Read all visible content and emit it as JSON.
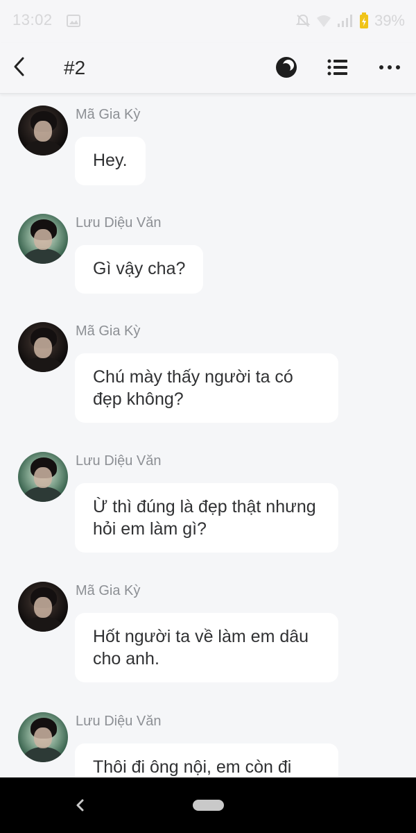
{
  "status_bar": {
    "time": "13:02",
    "battery_percent": "39%",
    "icons": [
      "photo-icon",
      "mute-icon",
      "wifi-icon",
      "signal-icon",
      "battery-icon"
    ]
  },
  "header": {
    "title": "#2",
    "icons": [
      "back-icon",
      "theme-toggle-icon",
      "list-icon",
      "more-icon"
    ]
  },
  "messages": [
    {
      "sender": "Mã Gia Kỳ",
      "text": "Hey.",
      "avatar": "dark"
    },
    {
      "sender": "Lưu Diệu Văn",
      "text": "Gì vậy cha?",
      "avatar": "green"
    },
    {
      "sender": "Mã Gia Kỳ",
      "text": "Chú mày thấy người ta có đẹp không?",
      "avatar": "dark"
    },
    {
      "sender": "Lưu Diệu Văn",
      "text": "Ừ thì đúng là đẹp thật nhưng hỏi em làm gì?",
      "avatar": "green"
    },
    {
      "sender": "Mã Gia Kỳ",
      "text": "Hốt người ta về làm em dâu cho anh.",
      "avatar": "dark"
    },
    {
      "sender": "Lưu Diệu Văn",
      "text": "Thôi đi ông nội, em còn đi",
      "avatar": "green"
    }
  ],
  "colors": {
    "background": "#f5f6f8",
    "bubble": "#ffffff",
    "sender_name": "#8c8f94",
    "message_text": "#303133",
    "battery_accent": "#f0c419",
    "nav_bar": "#000000"
  }
}
